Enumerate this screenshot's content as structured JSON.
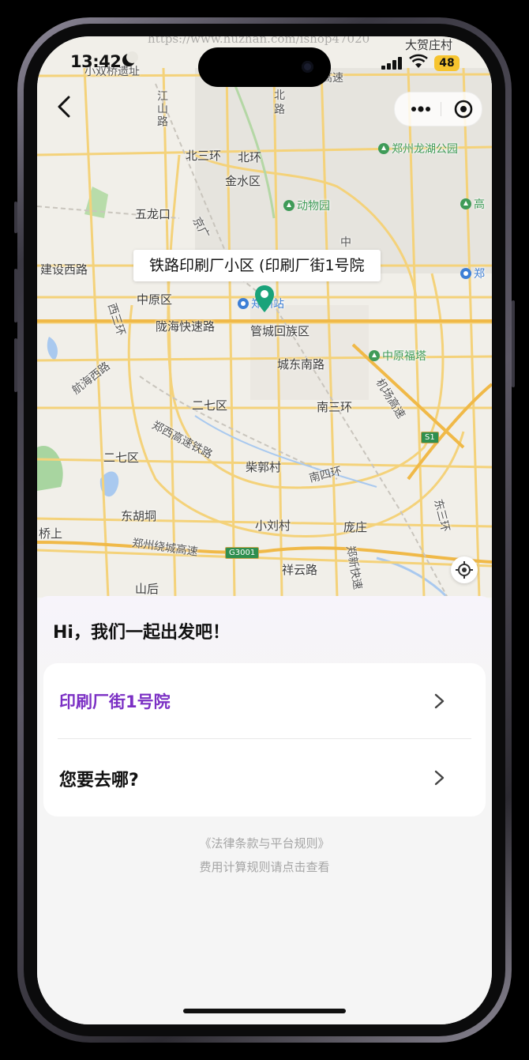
{
  "status_bar": {
    "time": "13:42",
    "carrier": "大贺庄村",
    "battery": "48",
    "watermark": "https://www.huzhan.com/ishop47020"
  },
  "map": {
    "labels": {
      "l01": "小双桥遗址",
      "l02": "高速",
      "l03": "北",
      "l04": "路",
      "l05": "江山路",
      "l06": "北三环",
      "l07": "北环",
      "l08": "金水区",
      "l09": "郑州龙湖公园",
      "l10": "五龙口",
      "l11": "动物园",
      "l12": "高",
      "l13": "京广",
      "l14": "中",
      "l15": "建设西路",
      "l16": "郑",
      "l17": "中原区",
      "l18": "郑州站",
      "l19": "西三环",
      "l20": "陇海快速路",
      "l21": "管城回族区",
      "l22": "城东南路",
      "l23": "中原福塔",
      "l24": "航海西路",
      "l25": "二七区",
      "l26": "南三环",
      "l27": "机场高速",
      "l28": "S1",
      "l29": "郑西高速铁路",
      "l30": "二七区",
      "l31": "柴郭村",
      "l32": "南四环",
      "l33": "东三环",
      "l34": "东胡垌",
      "l35": "小刘村",
      "l36": "庞庄",
      "l37": "郑新快速",
      "l38": "桥上",
      "l39": "郑州绕城高速",
      "l40": "G3001",
      "l41": "祥云路",
      "l42": "山后"
    },
    "location_label": "铁路印刷厂小区 (印刷厂街1号院"
  },
  "panel": {
    "greeting": "Hi，我们一起出发吧！",
    "origin": "印刷厂街1号院",
    "destination_prompt": "您要去哪?",
    "legal_link": "《法律条款与平台规则》",
    "fee_rules": "费用计算规则请点击查看"
  },
  "colors": {
    "accent_purple": "#7b2fc4",
    "pin_green": "#1aa37a",
    "road_yellow": "#f4cf6e",
    "battery_yellow": "#f6c42f"
  },
  "icons": {
    "back": "back-arrow-icon",
    "more": "more-dots-icon",
    "close": "target-close-icon",
    "locate": "locate-icon",
    "pin": "map-pin-icon",
    "chevron": "chevron-right-icon"
  }
}
